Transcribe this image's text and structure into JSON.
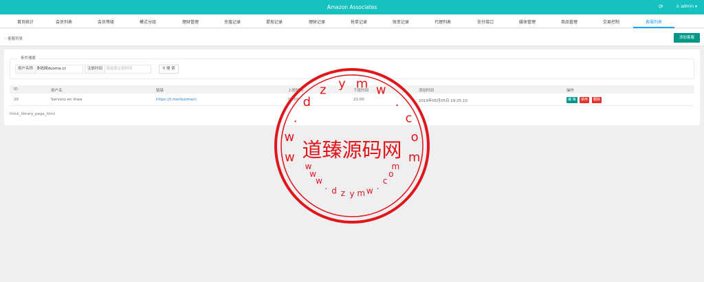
{
  "app": {
    "title": "Amazon Associates",
    "refresh_icon": "refresh-icon",
    "user_label": "admin",
    "user_icon": "user-icon"
  },
  "nav": {
    "tabs": [
      {
        "label": "首页统计",
        "active": false
      },
      {
        "label": "会员列表",
        "active": false
      },
      {
        "label": "会员等级",
        "active": false
      },
      {
        "label": "模式分组",
        "active": false
      },
      {
        "label": "理财管理",
        "active": false
      },
      {
        "label": "充值记录",
        "active": false
      },
      {
        "label": "提现记录",
        "active": false
      },
      {
        "label": "理财记录",
        "active": false
      },
      {
        "label": "抢单记录",
        "active": false
      },
      {
        "label": "账变记录",
        "active": false
      },
      {
        "label": "代理列表",
        "active": false
      },
      {
        "label": "支付接口",
        "active": false
      },
      {
        "label": "媒体管理",
        "active": false
      },
      {
        "label": "商品管理",
        "active": false
      },
      {
        "label": "交易控制",
        "active": false
      },
      {
        "label": "客服列表",
        "active": true
      }
    ]
  },
  "page": {
    "breadcrumb": "客服列表",
    "add_button": "添加客服"
  },
  "search": {
    "legend": "条件搜索",
    "username_label": "用户名称",
    "username_value": "多码网duoma.cc",
    "regtime_label": "注册时间",
    "regtime_placeholder": "请选择注册时间",
    "search_button": "搜 索",
    "search_icon": "search-icon"
  },
  "table": {
    "headers": [
      "ID",
      "用户名",
      "链接",
      "上班时间",
      "下班时间",
      "添加时间",
      "操作"
    ],
    "rows": [
      {
        "id": "20",
        "username": "Servicio en línea",
        "link": "https://t.me/duomacc",
        "on_time": "09:00",
        "off_time": "21:00",
        "created": "2019年05月05日 19:25:10",
        "actions": [
          "编 辑",
          "禁用",
          "删除"
        ]
      }
    ]
  },
  "footnote": "think_library_page_html",
  "watermark": {
    "center_text": "道臻源码网",
    "top_arc": [
      "w",
      "w",
      ".",
      "d",
      "z",
      "y",
      "m",
      "w",
      ".",
      "c",
      "o",
      "m"
    ],
    "bottom_arc": [
      "w",
      "w",
      "w",
      ".",
      "d",
      "z",
      "y",
      "m",
      "w",
      ".",
      "c",
      "o",
      "m"
    ],
    "color": "#e0161b"
  },
  "colors": {
    "topbar": "#16c2c0",
    "accent": "#1e9fff",
    "primary_button": "#009688",
    "danger": "#e4302a"
  }
}
